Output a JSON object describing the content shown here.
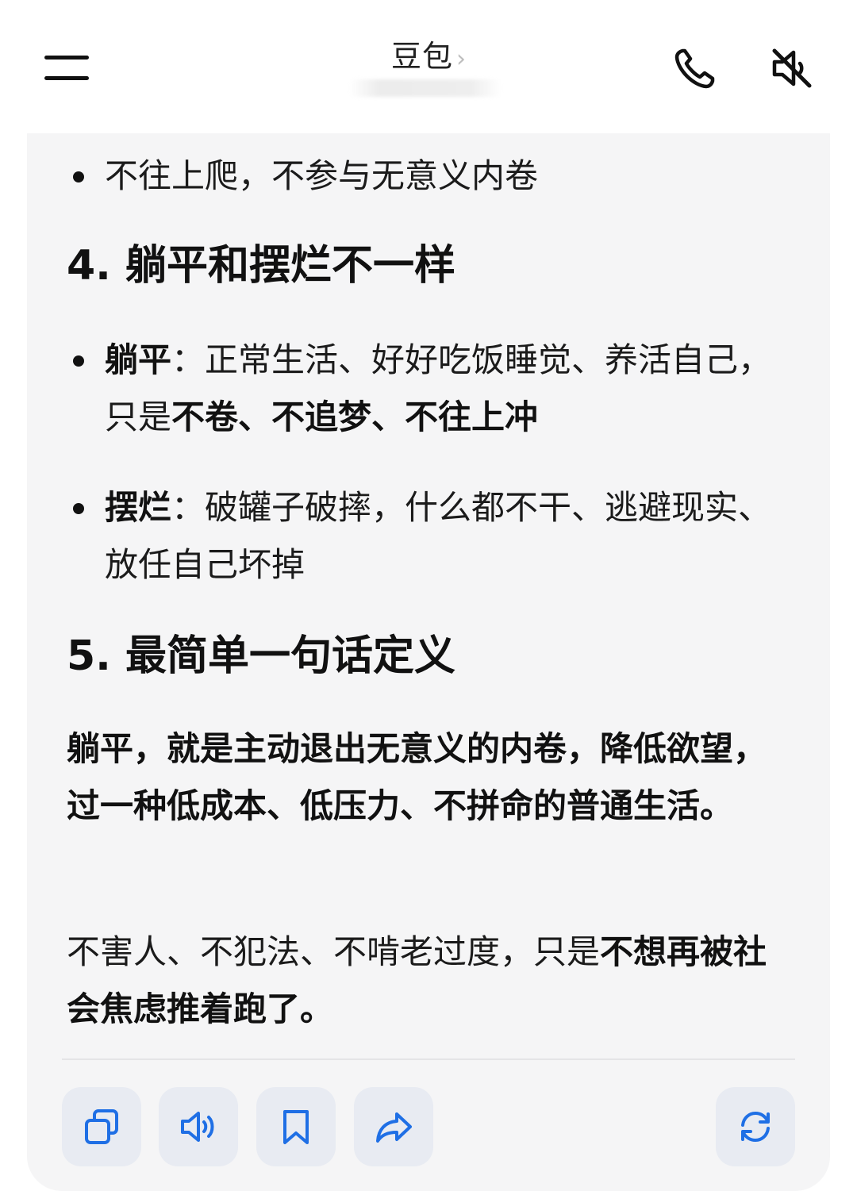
{
  "header": {
    "title": "豆包",
    "chevron": "›"
  },
  "content": {
    "bullet_top": "不往上爬，不参与无意义内卷",
    "section4": {
      "heading": "4. 躺平和摆烂不一样",
      "items": [
        {
          "term": "躺平",
          "sep": "：",
          "text": "正常生活、好好吃饭睡觉、养活自己，只是",
          "bold_tail": "不卷、不追梦、不往上冲"
        },
        {
          "term": "摆烂",
          "sep": "：",
          "text": "破罐子破摔，什么都不干、逃避现实、放任自己坏掉"
        }
      ]
    },
    "section5": {
      "heading": "5. 最简单一句话定义",
      "definition": "躺平，就是主动退出无意义的内卷，降低欲望，过一种低成本、低压力、不拼命的普通生活。",
      "closing_plain": "不害人、不犯法、不啃老过度，只是",
      "closing_bold": "不想再被社会焦虑推着跑了。"
    }
  },
  "actions": [
    {
      "name": "copy-icon"
    },
    {
      "name": "speaker-icon"
    },
    {
      "name": "bookmark-icon"
    },
    {
      "name": "share-icon"
    },
    {
      "name": "refresh-icon"
    }
  ],
  "colors": {
    "accent": "#1f6fe5",
    "card_bg": "#f5f5f6",
    "action_bg": "#e8ebf2"
  }
}
